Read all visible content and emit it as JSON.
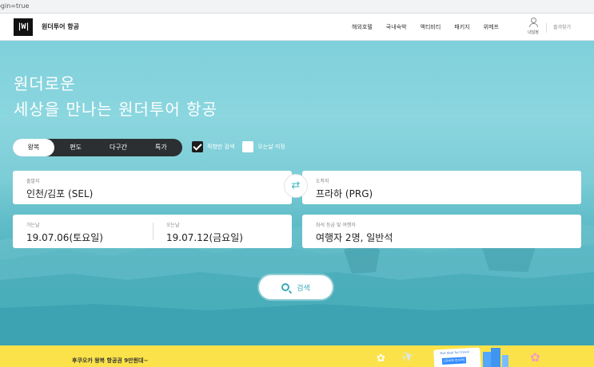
{
  "browser": {
    "url_fragment": "ogin=true"
  },
  "nav": {
    "logo_text": "|W|",
    "brand": "원더투어 항공",
    "links": [
      "해외호텔",
      "국내숙박",
      "액티비티",
      "패키지",
      "위메프"
    ],
    "mypage_label": "내일정",
    "favorites_label": "즐겨찾기"
  },
  "hero": {
    "headline_line1": "원더로운",
    "headline_line2": "세상을 만나는 원더투어 항공",
    "trip_types": [
      "왕복",
      "편도",
      "다구간",
      "특가"
    ],
    "active_trip": "왕복",
    "options": {
      "direct_label": "직항만 검색",
      "direct_checked": true,
      "return_undecided_label": "오는날 미정",
      "return_undecided_checked": false
    },
    "departure": {
      "label": "출발지",
      "value": "인천/김포 (SEL)"
    },
    "arrival": {
      "label": "도착지",
      "value": "프라하 (PRG)"
    },
    "depart_date": {
      "label": "가는날",
      "value": "19.07.06(토요일)"
    },
    "return_date": {
      "label": "오는날",
      "value": "19.07.12(금요일)"
    },
    "passengers": {
      "label": "좌석 등급 및 여행자",
      "value": "여행자 2명, 일반석"
    },
    "search_label": "검색",
    "swap_icon": "swap-arrows-icon"
  },
  "banner": {
    "text": "후쿠오카 왕복 항공권 9만원대~",
    "ticket_top": "Hot deal for travel",
    "ticket_mid": "[전세계 전지역]"
  },
  "colors": {
    "accent": "#3aa9b8",
    "banner": "#fbe24a",
    "dark": "#2b2f31"
  }
}
